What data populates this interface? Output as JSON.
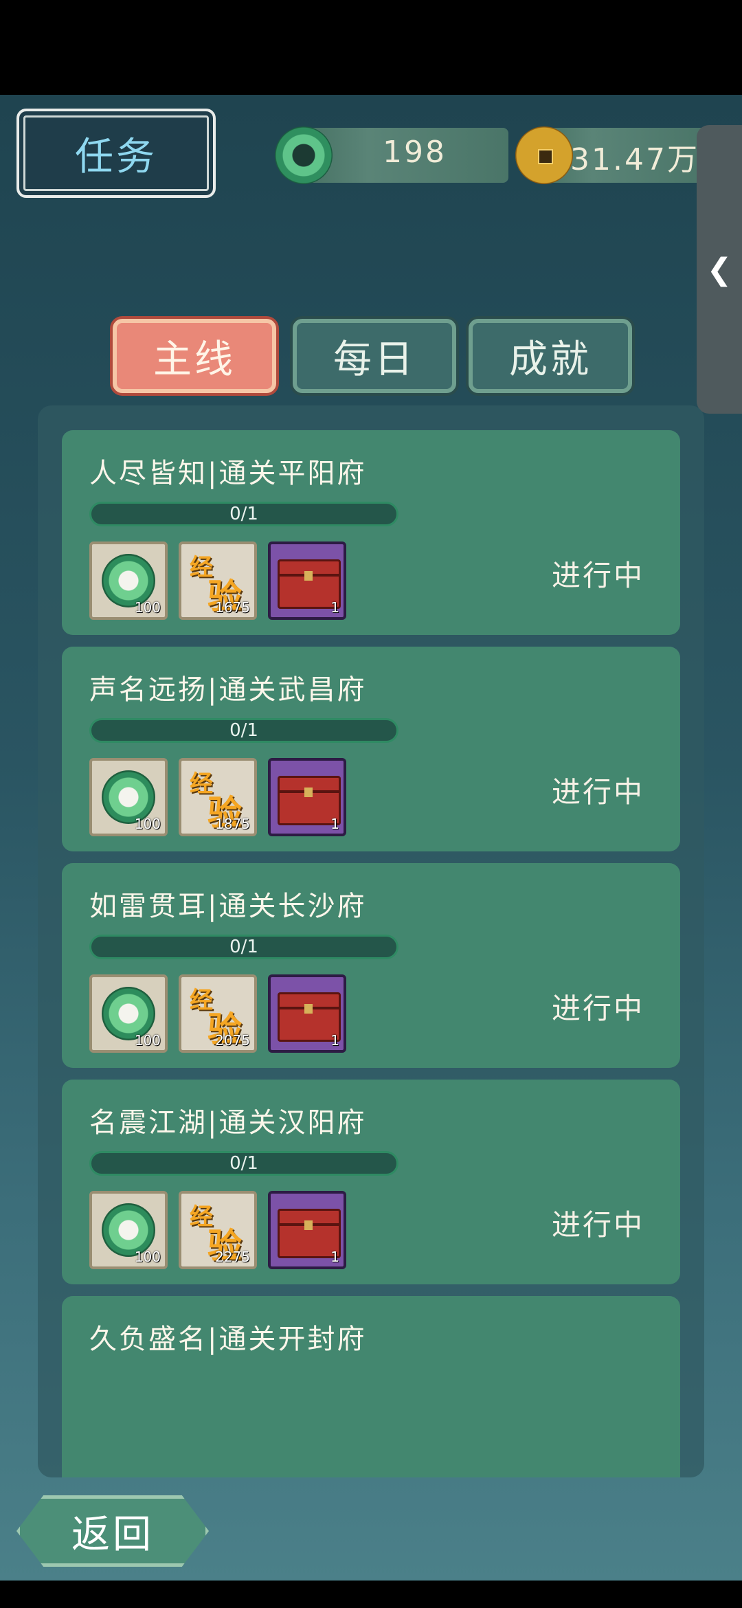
{
  "header": {
    "title": "任务",
    "currencies": [
      {
        "name": "jade",
        "value": "198"
      },
      {
        "name": "coin",
        "value": "31.47万"
      }
    ],
    "side_handle_icon": "chevron-left-icon"
  },
  "tabs": [
    {
      "label": "主线",
      "active": true
    },
    {
      "label": "每日",
      "active": false
    },
    {
      "label": "成就",
      "active": false
    }
  ],
  "quests": [
    {
      "title": "人尽皆知|通关平阳府",
      "progress": "0/1",
      "progress_fraction": 0,
      "rewards": [
        {
          "type": "jade",
          "qty": "100"
        },
        {
          "type": "exp",
          "text_top": "经",
          "text_bottom": "验",
          "qty": "1675"
        },
        {
          "type": "chest",
          "qty": "1"
        }
      ],
      "status": "进行中"
    },
    {
      "title": "声名远扬|通关武昌府",
      "progress": "0/1",
      "progress_fraction": 0,
      "rewards": [
        {
          "type": "jade",
          "qty": "100"
        },
        {
          "type": "exp",
          "text_top": "经",
          "text_bottom": "验",
          "qty": "1875"
        },
        {
          "type": "chest",
          "qty": "1"
        }
      ],
      "status": "进行中"
    },
    {
      "title": "如雷贯耳|通关长沙府",
      "progress": "0/1",
      "progress_fraction": 0,
      "rewards": [
        {
          "type": "jade",
          "qty": "100"
        },
        {
          "type": "exp",
          "text_top": "经",
          "text_bottom": "验",
          "qty": "2075"
        },
        {
          "type": "chest",
          "qty": "1"
        }
      ],
      "status": "进行中"
    },
    {
      "title": "名震江湖|通关汉阳府",
      "progress": "0/1",
      "progress_fraction": 0,
      "rewards": [
        {
          "type": "jade",
          "qty": "100"
        },
        {
          "type": "exp",
          "text_top": "经",
          "text_bottom": "验",
          "qty": "2275"
        },
        {
          "type": "chest",
          "qty": "1"
        }
      ],
      "status": "进行中"
    },
    {
      "title": "久负盛名|通关开封府"
    }
  ],
  "back_button": {
    "label": "返回"
  }
}
